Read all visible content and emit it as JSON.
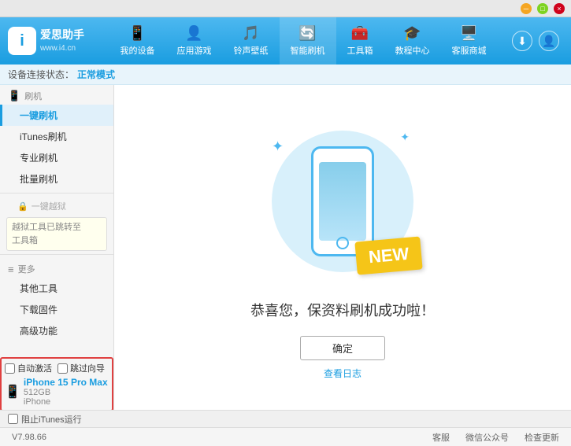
{
  "app": {
    "logo_line1": "爱思助手",
    "logo_line2": "www.i4.cn"
  },
  "nav": {
    "items": [
      {
        "label": "我的设备",
        "icon": "📱"
      },
      {
        "label": "应用游戏",
        "icon": "👤"
      },
      {
        "label": "铃声壁纸",
        "icon": "🎵"
      },
      {
        "label": "智能刷机",
        "icon": "🔄"
      },
      {
        "label": "工具箱",
        "icon": "🧰"
      },
      {
        "label": "教程中心",
        "icon": "🎓"
      },
      {
        "label": "客服商城",
        "icon": "🖥️"
      }
    ]
  },
  "window_controls": {
    "minimize": "─",
    "maximize": "□",
    "close": "×"
  },
  "subheader": {
    "prefix": "设备连接状态：",
    "mode": "正常模式"
  },
  "sidebar": {
    "section1_label": "刷机",
    "items": [
      {
        "label": "一键刷机",
        "active": true
      },
      {
        "label": "iTunes刷机"
      },
      {
        "label": "专业刷机"
      },
      {
        "label": "批量刷机"
      }
    ],
    "locked_label": "一键越狱",
    "locked_notice_line1": "越狱工具已跳转至",
    "locked_notice_line2": "工具箱",
    "section2_label": "更多",
    "items2": [
      {
        "label": "其他工具"
      },
      {
        "label": "下载固件"
      },
      {
        "label": "高级功能"
      }
    ]
  },
  "device_panel": {
    "auto_activate_label": "自动激活",
    "quick_guide_label": "跳过向导",
    "device_icon": "📱",
    "device_name": "iPhone 15 Pro Max",
    "device_storage": "512GB",
    "device_type": "iPhone"
  },
  "content": {
    "new_badge": "NEW",
    "success_text": "恭喜您，保资料刷机成功啦！",
    "confirm_btn": "确定",
    "log_link": "查看日志"
  },
  "footer": {
    "version": "V7.98.66",
    "items": [
      "客服",
      "微信公众号",
      "检查更新"
    ]
  },
  "itunes_bar": {
    "label": "阻止iTunes运行"
  }
}
